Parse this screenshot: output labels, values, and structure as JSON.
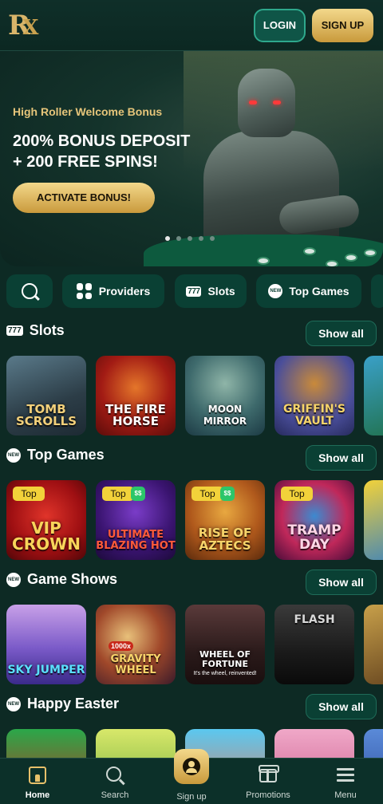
{
  "header": {
    "logo_text": "R",
    "logo_mark": "X",
    "login_label": "LOGIN",
    "signup_label": "SIGN UP"
  },
  "hero": {
    "subtitle": "High Roller Welcome Bonus",
    "title_line1": "200% BONUS DEPOSIT",
    "title_line2": "+ 200 FREE SPINS!",
    "cta_label": "ACTIVATE BONUS!",
    "slides_total": 5,
    "active_slide": 1
  },
  "category_nav": {
    "items": [
      {
        "label": "",
        "icon": "search-icon"
      },
      {
        "label": "Providers",
        "icon": "grid-icon"
      },
      {
        "label": "Slots",
        "icon": "777-icon"
      },
      {
        "label": "Top Games",
        "icon": "new-badge-icon"
      }
    ]
  },
  "sections": [
    {
      "title": "Slots",
      "icon": "777-icon",
      "show_all": "Show all",
      "tiles": [
        {
          "name": "TOMB SCROLLS",
          "badge": "",
          "jackpot": false
        },
        {
          "name": "THE FIRE HORSE",
          "badge": "",
          "jackpot": false
        },
        {
          "name": "MOON MIRROR",
          "badge": "",
          "jackpot": false
        },
        {
          "name": "GRIFFIN'S VAULT",
          "badge": "",
          "jackpot": false
        }
      ]
    },
    {
      "title": "Top Games",
      "icon": "new-badge-icon",
      "show_all": "Show all",
      "tiles": [
        {
          "name": "VIP CROWN",
          "badge": "Top",
          "jackpot": false
        },
        {
          "name": "ULTIMATE BLAZING HOT",
          "badge": "Top",
          "jackpot": true
        },
        {
          "name": "RISE OF AZTECS",
          "badge": "Top",
          "jackpot": true
        },
        {
          "name": "TRAMP DAY",
          "badge": "Top",
          "jackpot": false
        }
      ]
    },
    {
      "title": "Game Shows",
      "icon": "new-badge-icon",
      "show_all": "Show all",
      "tiles": [
        {
          "name": "SKY JUMPER",
          "badge": "",
          "jackpot": false
        },
        {
          "name": "GRAVITY WHEEL",
          "badge": "",
          "jackpot": false
        },
        {
          "name": "WHEEL OF FORTUNE",
          "badge": "",
          "jackpot": false
        },
        {
          "name": "FLASH",
          "badge": "",
          "jackpot": false
        }
      ]
    },
    {
      "title": "Happy Easter",
      "icon": "new-badge-icon",
      "show_all": "Show all",
      "tiles": []
    }
  ],
  "tile_extras": {
    "wheel_of_fortune_tagline": "It's the wheel, reinvented!",
    "gravity_wheel_multiplier": "1000x",
    "jackpot_badge_text": "$$"
  },
  "bottom_nav": {
    "items": [
      {
        "label": "Home",
        "icon": "home-icon",
        "active": true
      },
      {
        "label": "Search",
        "icon": "search-icon",
        "active": false
      },
      {
        "label": "Sign up",
        "icon": "user-icon",
        "active": false
      },
      {
        "label": "Promotions",
        "icon": "gift-icon",
        "active": false
      },
      {
        "label": "Menu",
        "icon": "menu-icon",
        "active": false
      }
    ]
  },
  "colors": {
    "background": "#0d2a24",
    "accent_gold": "#e6c57a",
    "button_teal": "#0a4034",
    "badge_top": "#f2d23a",
    "badge_jackpot": "#2cc66a"
  }
}
